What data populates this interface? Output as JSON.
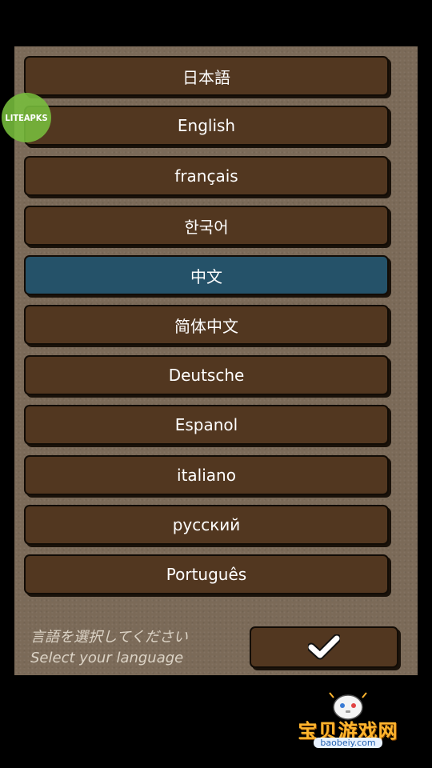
{
  "language_list": [
    {
      "label": "日本語",
      "selected": false
    },
    {
      "label": "English",
      "selected": false
    },
    {
      "label": "français",
      "selected": false
    },
    {
      "label": "한국어",
      "selected": false
    },
    {
      "label": "中文",
      "selected": true
    },
    {
      "label": "简体中文",
      "selected": false
    },
    {
      "label": "Deutsche",
      "selected": false
    },
    {
      "label": "Espanol",
      "selected": false
    },
    {
      "label": "italiano",
      "selected": false
    },
    {
      "label": "русский",
      "selected": false
    },
    {
      "label": "Português",
      "selected": false
    }
  ],
  "prompt": {
    "japanese": "言語を選択してください",
    "english": "Select your language"
  },
  "confirm_button": {
    "icon": "checkmark-icon"
  },
  "watermark_badge": {
    "text": "LITEAPKS"
  },
  "corner_logo": {
    "title": "宝贝游戏网",
    "subtitle": "baobeiy.com"
  },
  "colors": {
    "button_brown": "#523720",
    "selected_blue": "#255269",
    "panel_bg": "#7b6a58"
  }
}
